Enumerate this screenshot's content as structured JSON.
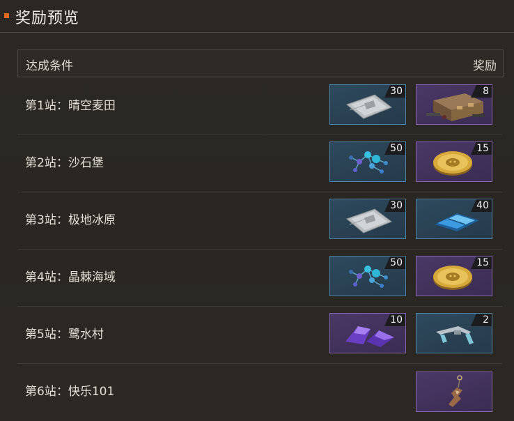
{
  "title": "奖励预览",
  "header": {
    "condition": "达成条件",
    "reward": "奖励"
  },
  "rows": [
    {
      "label": "第1站：晴空麦田",
      "rewards": [
        {
          "icon": "supply-pack-icon",
          "qty": "30",
          "rarity": "blue"
        },
        {
          "icon": "weapon-crate-icon",
          "qty": "8",
          "rarity": "purple"
        }
      ]
    },
    {
      "label": "第2站：沙石堡",
      "rewards": [
        {
          "icon": "molecule-icon",
          "qty": "50",
          "rarity": "blue"
        },
        {
          "icon": "gold-coin-icon",
          "qty": "15",
          "rarity": "purple"
        }
      ]
    },
    {
      "label": "第3站：极地冰原",
      "rewards": [
        {
          "icon": "supply-pack-icon",
          "qty": "30",
          "rarity": "blue"
        },
        {
          "icon": "blue-plate-icon",
          "qty": "40",
          "rarity": "blue"
        }
      ]
    },
    {
      "label": "第4站：晶棘海域",
      "rewards": [
        {
          "icon": "molecule-icon",
          "qty": "50",
          "rarity": "blue"
        },
        {
          "icon": "gold-coin-icon",
          "qty": "15",
          "rarity": "purple"
        }
      ]
    },
    {
      "label": "第5站：鹭水村",
      "rewards": [
        {
          "icon": "purple-crystal-icon",
          "qty": "10",
          "rarity": "purple"
        },
        {
          "icon": "metal-clip-icon",
          "qty": "2",
          "rarity": "blue"
        }
      ]
    },
    {
      "label": "第6站：快乐101",
      "rewards": [
        {
          "icon": "weapon-charm-icon",
          "qty": "",
          "rarity": "purple"
        }
      ]
    }
  ]
}
